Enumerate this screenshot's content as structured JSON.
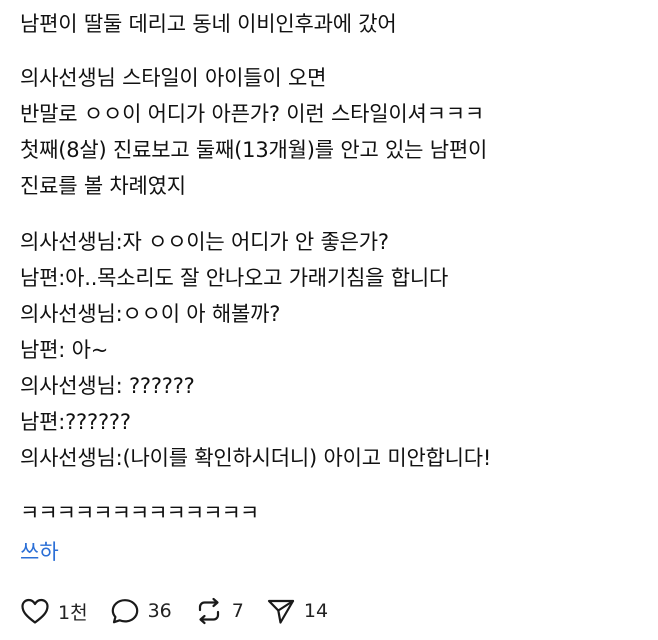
{
  "post": {
    "paragraphs": [
      [
        "남편이 딸둘 데리고 동네 이비인후과에 갔어"
      ],
      [
        "의사선생님 스타일이 아이들이 오면",
        "반말로 ㅇㅇ이 어디가 아픈가? 이런 스타일이셔ㅋㅋㅋ",
        "첫째(8살) 진료보고 둘째(13개월)를 안고 있는 남편이",
        "진료를 볼 차례였지"
      ],
      [
        "의사선생님:자 ㅇㅇ이는 어디가 안 좋은가?",
        "남편:아..목소리도 잘 안나오고 가래기침을 합니다",
        "의사선생님:ㅇㅇ이 아 해볼까?",
        "남편: 아~",
        "의사선생님: ??????",
        "남편:??????",
        "의사선생님:(나이를 확인하시더니) 아이고 미안합니다!"
      ],
      [
        "ㅋㅋㅋㅋㅋㅋㅋㅋㅋㅋㅋㅋㅋ"
      ]
    ],
    "tag": "쓰하"
  },
  "actions": {
    "like_count": "1천",
    "reply_count": "36",
    "repost_count": "7",
    "share_count": "14"
  },
  "icons": [
    "heart-icon",
    "reply-icon",
    "repost-icon",
    "send-icon"
  ]
}
